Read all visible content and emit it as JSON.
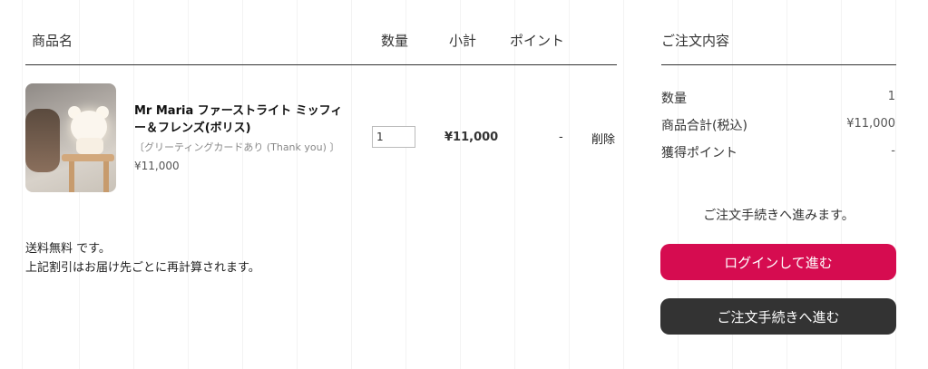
{
  "cart": {
    "headers": {
      "product": "商品名",
      "quantity": "数量",
      "subtotal": "小計",
      "points": "ポイント"
    },
    "item": {
      "name": "Mr Maria ファーストライト ミッフィー＆フレンズ(ボリス)",
      "note": "〔グリーティングカードあり (Thank you) 〕",
      "price": "¥11,000",
      "quantity": "1",
      "subtotal": "¥11,000",
      "points": "-",
      "delete_label": "削除"
    },
    "notes": {
      "shipping": "送料無料 です。",
      "discount": "上記割引はお届け先ごとに再計算されます。"
    }
  },
  "summary": {
    "title": "ご注文内容",
    "rows": [
      {
        "label": "数量",
        "value": "1"
      },
      {
        "label": "商品合計(税込)",
        "value": "¥11,000"
      },
      {
        "label": "獲得ポイント",
        "value": "-"
      }
    ],
    "proceed_text": "ご注文手続きへ進みます。",
    "login_button": "ログインして進む",
    "checkout_button": "ご注文手続きへ進む",
    "colors": {
      "login": "#d60c50",
      "checkout": "#333333"
    }
  }
}
